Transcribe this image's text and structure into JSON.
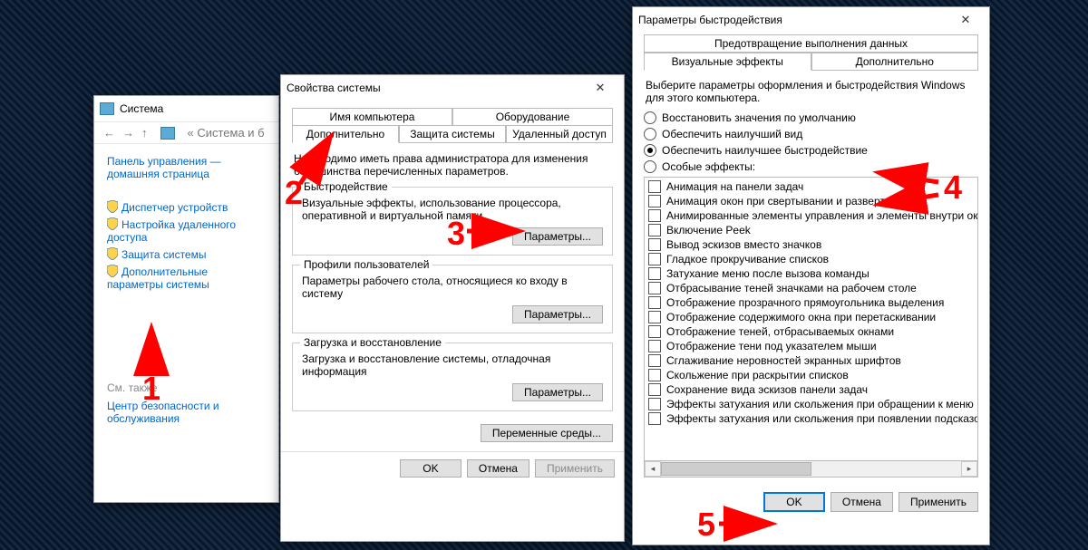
{
  "annotations": {
    "n1": "1",
    "n2": "2",
    "n3": "3",
    "n4": "4",
    "n5": "5"
  },
  "win1": {
    "title": "Система",
    "breadcrumb": "« Система и б",
    "cp_home1": "Панель управления —",
    "cp_home2": "домашняя страница",
    "links": [
      "Диспетчер устройств",
      "Настройка удаленного доступа",
      "Защита системы",
      "Дополнительные параметры системы"
    ],
    "seealso": "См. также",
    "seealso_link": "Центр безопасности и обслуживания"
  },
  "win2": {
    "title": "Свойства системы",
    "tabs_top": [
      "Имя компьютера",
      "Оборудование"
    ],
    "tabs_bot": [
      "Дополнительно",
      "Защита системы",
      "Удаленный доступ"
    ],
    "intro": "Необходимо иметь права администратора для изменения большинства перечисленных параметров.",
    "g1": {
      "title": "Быстродействие",
      "desc": "Визуальные эффекты, использование процессора, оперативной и виртуальной памяти",
      "btn": "Параметры..."
    },
    "g2": {
      "title": "Профили пользователей",
      "desc": "Параметры рабочего стола, относящиеся ко входу в систему",
      "btn": "Параметры..."
    },
    "g3": {
      "title": "Загрузка и восстановление",
      "desc": "Загрузка и восстановление системы, отладочная информация",
      "btn": "Параметры..."
    },
    "envvars": "Переменные среды...",
    "ok": "OK",
    "cancel": "Отмена",
    "apply": "Применить"
  },
  "win3": {
    "title": "Параметры быстродействия",
    "tab_dep": "Предотвращение выполнения данных",
    "tab_vis": "Визуальные эффекты",
    "tab_adv": "Дополнительно",
    "desc": "Выберите параметры оформления и быстродействия Windows для этого компьютера.",
    "r1": "Восстановить значения по умолчанию",
    "r2": "Обеспечить наилучший вид",
    "r3": "Обеспечить наилучшее быстродействие",
    "r4": "Особые эффекты:",
    "items": [
      "Анимация на панели задач",
      "Анимация окон при свертывании и развертывании",
      "Анимированные элементы управления и элементы внутри окн",
      "Включение Peek",
      "Вывод эскизов вместо значков",
      "Гладкое прокручивание списков",
      "Затухание меню после вызова команды",
      "Отбрасывание теней значками на рабочем столе",
      "Отображение прозрачного прямоугольника выделения",
      "Отображение содержимого окна при перетаскивании",
      "Отображение теней, отбрасываемых окнами",
      "Отображение тени под указателем мыши",
      "Сглаживание неровностей экранных шрифтов",
      "Скольжение при раскрытии списков",
      "Сохранение вида эскизов панели задач",
      "Эффекты затухания или скольжения при обращении к меню",
      "Эффекты затухания или скольжения при появлении подсказок"
    ],
    "ok": "OK",
    "cancel": "Отмена",
    "apply": "Применить"
  }
}
